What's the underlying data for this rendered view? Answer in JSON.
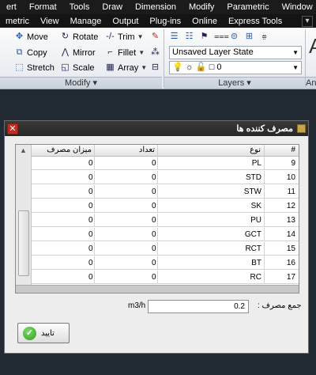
{
  "menubar": {
    "items": [
      "ert",
      "Format",
      "Tools",
      "Draw",
      "Dimension",
      "Modify",
      "Parametric",
      "Window"
    ]
  },
  "menubar2": {
    "items": [
      "metric",
      "View",
      "Manage",
      "Output",
      "Plug-ins",
      "Online",
      "Express Tools"
    ]
  },
  "ribbon": {
    "modify": {
      "move": "Move",
      "rotate": "Rotate",
      "trim": "Trim",
      "copy": "Copy",
      "mirror": "Mirror",
      "fillet": "Fillet",
      "stretch": "Stretch",
      "scale": "Scale",
      "array": "Array",
      "panel_label": "Modify"
    },
    "layers": {
      "layer_state": "Unsaved Layer State",
      "current_layer": "0",
      "panel_label": "Layers"
    },
    "annotation_panel_label": "An"
  },
  "dialog": {
    "title": "مصرف کننده ها",
    "columns": {
      "num": "#",
      "type": "نوع",
      "count": "تعداد",
      "usage": "میزان مصرف"
    },
    "rows": [
      {
        "num": "9",
        "type": "PL",
        "count": "0",
        "usage": "0"
      },
      {
        "num": "10",
        "type": "STD",
        "count": "0",
        "usage": "0"
      },
      {
        "num": "11",
        "type": "STW",
        "count": "0",
        "usage": "0"
      },
      {
        "num": "12",
        "type": "SK",
        "count": "0",
        "usage": "0"
      },
      {
        "num": "13",
        "type": "PU",
        "count": "0",
        "usage": "0"
      },
      {
        "num": "14",
        "type": "GCT",
        "count": "0",
        "usage": "0"
      },
      {
        "num": "15",
        "type": "RCT",
        "count": "0",
        "usage": "0"
      },
      {
        "num": "16",
        "type": "BT",
        "count": "0",
        "usage": "0"
      },
      {
        "num": "17",
        "type": "RC",
        "count": "0",
        "usage": "0"
      }
    ],
    "sum_label": "جمع مصرف :",
    "sum_value": "0.2",
    "sum_unit": "m3/h",
    "ok_label": "تایید"
  },
  "colors": {
    "menubar_bg": "#1b1b1b",
    "drawing_bg": "#222a33",
    "close_red": "#c42b1c",
    "ok_green": "#2a9d1a"
  }
}
